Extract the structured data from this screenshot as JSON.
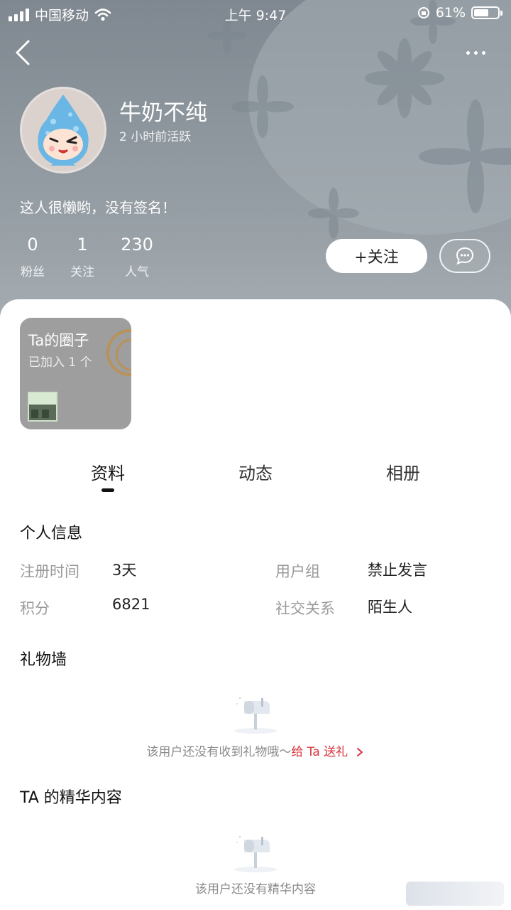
{
  "status_bar": {
    "carrier": "中国移动",
    "time": "上午 9:47",
    "battery_text": "61%",
    "battery_level": 0.61
  },
  "profile": {
    "username": "牛奶不纯",
    "active_time": "2 小时前活跃",
    "signature": "这人很懒哟，没有签名！",
    "stats": [
      {
        "value": "0",
        "label": "粉丝"
      },
      {
        "value": "1",
        "label": "关注"
      },
      {
        "value": "230",
        "label": "人气"
      }
    ],
    "follow_label": "+关注"
  },
  "circle_card": {
    "title": "Ta的圈子",
    "subtitle": "已加入 1 个"
  },
  "tabs": [
    {
      "label": "资料",
      "active": true
    },
    {
      "label": "动态",
      "active": false
    },
    {
      "label": "相册",
      "active": false
    }
  ],
  "personal_info": {
    "title": "个人信息",
    "rows": [
      {
        "label": "注册时间",
        "value": "3天"
      },
      {
        "label": "用户组",
        "value": "禁止发言"
      },
      {
        "label": "积分",
        "value": "6821"
      },
      {
        "label": "社交关系",
        "value": "陌生人"
      }
    ]
  },
  "gift_wall": {
    "title": "礼物墙",
    "empty_text": "该用户还没有收到礼物哦～",
    "gift_link": "给 Ta 送礼"
  },
  "featured": {
    "title": "TA 的精华内容",
    "empty_text": "该用户还没有精华内容"
  },
  "colors": {
    "accent_link": "#d8343c",
    "header_bg": "#8d969d"
  },
  "icons": [
    "back-icon",
    "more-icon",
    "message-icon",
    "mailbox-icon",
    "chevron-right-icon",
    "wifi-icon",
    "orientation-lock-icon"
  ]
}
